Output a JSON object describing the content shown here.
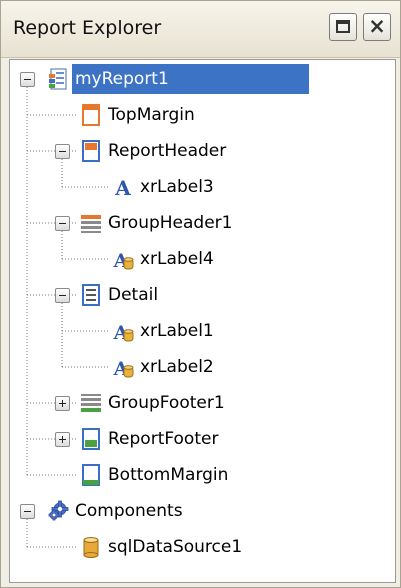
{
  "window": {
    "title": "Report Explorer",
    "restore_icon": "restore-window-icon",
    "close_icon": "close-icon"
  },
  "colors": {
    "selection": "#3d73c5",
    "band_orange": "#e8772e",
    "band_green": "#48a23f",
    "band_blue": "#3a6ec8"
  },
  "tree": [
    {
      "label": "myReport1",
      "icon": "report-icon",
      "expander": "minus",
      "selected": true
    },
    {
      "label": "TopMargin",
      "icon": "top-margin-band-icon"
    },
    {
      "label": "ReportHeader",
      "icon": "report-header-band-icon",
      "expander": "minus"
    },
    {
      "label": "xrLabel3",
      "icon": "label-icon"
    },
    {
      "label": "GroupHeader1",
      "icon": "group-header-band-icon",
      "expander": "minus"
    },
    {
      "label": "xrLabel4",
      "icon": "bound-label-icon"
    },
    {
      "label": "Detail",
      "icon": "detail-band-icon",
      "expander": "minus"
    },
    {
      "label": "xrLabel1",
      "icon": "bound-label-icon"
    },
    {
      "label": "xrLabel2",
      "icon": "bound-label-icon"
    },
    {
      "label": "GroupFooter1",
      "icon": "group-footer-band-icon",
      "expander": "plus"
    },
    {
      "label": "ReportFooter",
      "icon": "report-footer-band-icon",
      "expander": "plus"
    },
    {
      "label": "BottomMargin",
      "icon": "bottom-margin-band-icon"
    },
    {
      "label": "Components",
      "icon": "components-gear-icon",
      "expander": "minus"
    },
    {
      "label": "sqlDataSource1",
      "icon": "database-icon"
    }
  ]
}
